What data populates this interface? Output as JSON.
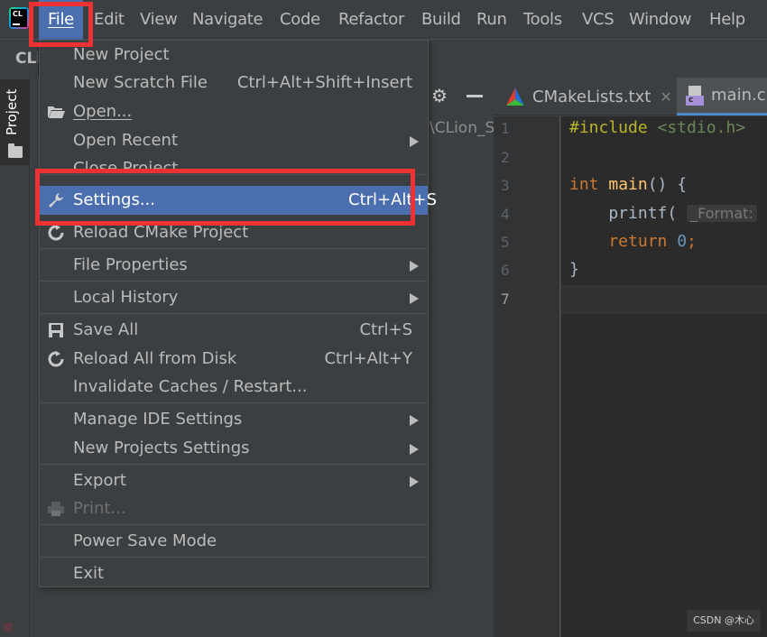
{
  "app": {
    "logo_text": "CL",
    "toolbar_title": "CLi"
  },
  "menubar": {
    "items": [
      {
        "label": "File",
        "mnemonic": "F",
        "active": true
      },
      {
        "label": "Edit",
        "mnemonic": "E"
      },
      {
        "label": "View",
        "mnemonic": "V"
      },
      {
        "label": "Navigate",
        "mnemonic": "N"
      },
      {
        "label": "Code",
        "mnemonic": "C"
      },
      {
        "label": "Refactor",
        "mnemonic": "R"
      },
      {
        "label": "Build",
        "mnemonic": "B"
      },
      {
        "label": "Run",
        "mnemonic": "u"
      },
      {
        "label": "Tools",
        "mnemonic": "T"
      },
      {
        "label": "VCS",
        "mnemonic": ""
      },
      {
        "label": "Window",
        "mnemonic": "W"
      },
      {
        "label": "Help",
        "mnemonic": "H"
      }
    ]
  },
  "tool_window": {
    "tab_label": "Project",
    "path_fragment": "\\CLion_S"
  },
  "file_menu": {
    "items": [
      {
        "label": "New Project",
        "shortcut": ""
      },
      {
        "label": "New Scratch File",
        "shortcut": "Ctrl+Alt+Shift+Insert"
      },
      {
        "label": "Open...",
        "icon": "folder-open-icon"
      },
      {
        "label": "Open Recent",
        "submenu": true
      },
      {
        "label": "Close Project"
      },
      {
        "label": "Settings...",
        "shortcut": "Ctrl+Alt+S",
        "icon": "wrench-icon",
        "selected": true
      },
      {
        "label": "Reload CMake Project",
        "icon": "reload-icon"
      },
      {
        "label": "File Properties",
        "submenu": true
      },
      {
        "label": "Local History",
        "submenu": true
      },
      {
        "label": "Save All",
        "shortcut": "Ctrl+S",
        "icon": "save-icon"
      },
      {
        "label": "Reload All from Disk",
        "shortcut": "Ctrl+Alt+Y",
        "icon": "reload-icon"
      },
      {
        "label": "Invalidate Caches / Restart..."
      },
      {
        "label": "Manage IDE Settings",
        "submenu": true
      },
      {
        "label": "New Projects Settings",
        "submenu": true
      },
      {
        "label": "Export",
        "submenu": true
      },
      {
        "label": "Print...",
        "icon": "print-icon",
        "disabled": true
      },
      {
        "label": "Power Save Mode"
      },
      {
        "label": "Exit"
      }
    ]
  },
  "editor": {
    "tabs": [
      {
        "label": "CMakeLists.txt",
        "icon": "cmake-icon",
        "closable": true
      },
      {
        "label": "main.c",
        "icon": "c-file-icon",
        "active": true
      }
    ],
    "line_numbers": [
      "1",
      "2",
      "3",
      "4",
      "5",
      "6",
      "7"
    ],
    "current_line": 7,
    "code": {
      "l1_directive": "#include",
      "l1_header": "<stdio.h>",
      "l3_type": "int",
      "l3_fn": "main",
      "l3_rest": "() {",
      "l4_call": "    printf(",
      "l4_hint": "_Format:",
      "l5_kw": "    return",
      "l5_num": "0",
      "l5_rest": ";",
      "l6": "}"
    }
  },
  "watermark": "CSDN @木心"
}
